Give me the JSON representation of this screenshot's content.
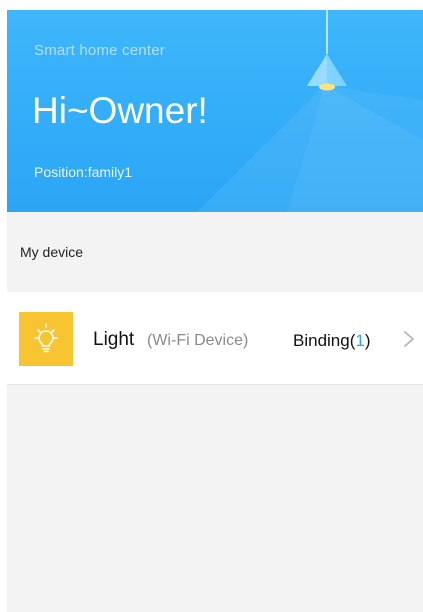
{
  "header": {
    "subtitle": "Smart home center",
    "greeting": "Hi~Owner!",
    "position": "Position:family1",
    "bg_color": "#2aa6f6"
  },
  "section": {
    "label": "My device"
  },
  "devices": [
    {
      "icon": "lightbulb-icon",
      "icon_bg": "#f7c531",
      "name": "Light",
      "type": "(Wi-Fi Device)",
      "binding_label": "Binding(",
      "binding_count": "1",
      "binding_close": ")"
    }
  ],
  "colors": {
    "accent": "#2aa6f6",
    "page_bg": "#f3f3f3"
  }
}
